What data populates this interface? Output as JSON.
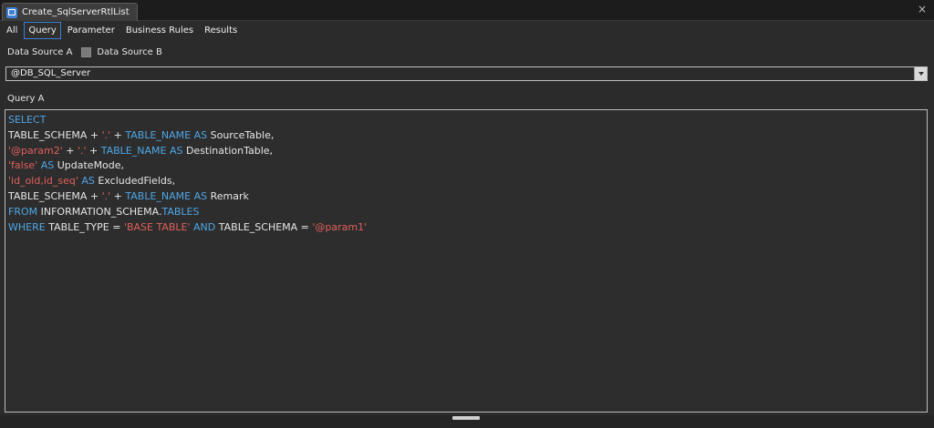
{
  "window": {
    "doc_tab_label": "Create_SqlServerRtlList",
    "icon": "database-window-icon",
    "close_glyph": "×"
  },
  "subtabs": [
    {
      "label": "All"
    },
    {
      "label": "Query"
    },
    {
      "label": "Parameter"
    },
    {
      "label": "Business Rules"
    },
    {
      "label": "Results"
    }
  ],
  "data_source": {
    "a_label": "Data Source A",
    "b_label": "Data Source B",
    "selected": "@DB_SQL_Server"
  },
  "query": {
    "label": "Query A",
    "lines": [
      [
        {
          "t": "SELECT",
          "c": "kw"
        }
      ],
      [
        {
          "t": "TABLE_SCHEMA + ",
          "c": "id"
        },
        {
          "t": "'.'",
          "c": "str"
        },
        {
          "t": " + ",
          "c": "id"
        },
        {
          "t": "TABLE_NAME AS",
          "c": "kw"
        },
        {
          "t": " SourceTable,",
          "c": "id"
        }
      ],
      [
        {
          "t": "'@param2'",
          "c": "str"
        },
        {
          "t": " + ",
          "c": "id"
        },
        {
          "t": "'.'",
          "c": "str"
        },
        {
          "t": " + ",
          "c": "id"
        },
        {
          "t": "TABLE_NAME AS",
          "c": "kw"
        },
        {
          "t": " DestinationTable,",
          "c": "id"
        }
      ],
      [
        {
          "t": "'false'",
          "c": "str"
        },
        {
          "t": " AS",
          "c": "kw"
        },
        {
          "t": " UpdateMode,",
          "c": "id"
        }
      ],
      [
        {
          "t": "'id_old,id_seq'",
          "c": "str"
        },
        {
          "t": " AS",
          "c": "kw"
        },
        {
          "t": " ExcludedFields,",
          "c": "id"
        }
      ],
      [
        {
          "t": "TABLE_SCHEMA + ",
          "c": "id"
        },
        {
          "t": "'.'",
          "c": "str"
        },
        {
          "t": " + ",
          "c": "id"
        },
        {
          "t": "TABLE_NAME AS",
          "c": "kw"
        },
        {
          "t": " Remark",
          "c": "id"
        }
      ],
      [
        {
          "t": "FROM",
          "c": "kw"
        },
        {
          "t": " INFORMATION_SCHEMA.",
          "c": "id"
        },
        {
          "t": "TABLES",
          "c": "kw"
        }
      ],
      [
        {
          "t": "WHERE",
          "c": "kw"
        },
        {
          "t": " TABLE_TYPE = ",
          "c": "id"
        },
        {
          "t": "'BASE TABLE'",
          "c": "str"
        },
        {
          "t": " AND",
          "c": "kw"
        },
        {
          "t": " TABLE_SCHEMA = ",
          "c": "id"
        },
        {
          "t": "'@param1'",
          "c": "str"
        }
      ]
    ]
  },
  "colors": {
    "keyword": "#4ea6e6",
    "string": "#e0605a",
    "identifier": "#e6e6e6",
    "accent": "#3c7fd1"
  }
}
